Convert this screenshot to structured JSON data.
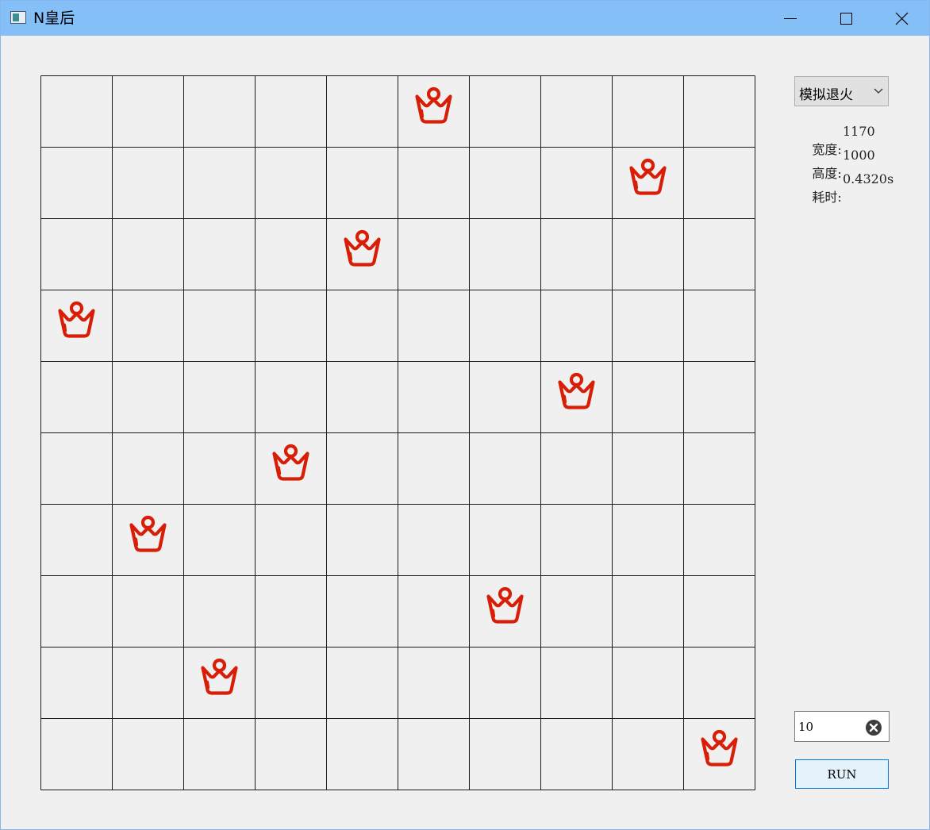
{
  "window": {
    "title": "N皇后"
  },
  "title_bar": {
    "minimize_icon": "minimize-icon",
    "maximize_icon": "maximize-icon",
    "close_icon": "close-icon"
  },
  "board": {
    "size": 10,
    "queen_columns_by_row": [
      5,
      8,
      4,
      0,
      7,
      3,
      1,
      6,
      2,
      9
    ],
    "queen_icon": "crown-icon",
    "queen_color": "#d81e06",
    "grid_color": "#1a1a1a"
  },
  "controls": {
    "algorithm_select": {
      "value": "模拟退火"
    },
    "info": {
      "width_label": "宽度:",
      "width_value": "1170",
      "height_label": "高度:",
      "height_value": "1000",
      "time_label": "耗时:",
      "time_value": "0.4320s"
    },
    "n_input": {
      "value": "10",
      "clear_icon": "clear-icon"
    },
    "run_button": {
      "label": "RUN"
    }
  }
}
